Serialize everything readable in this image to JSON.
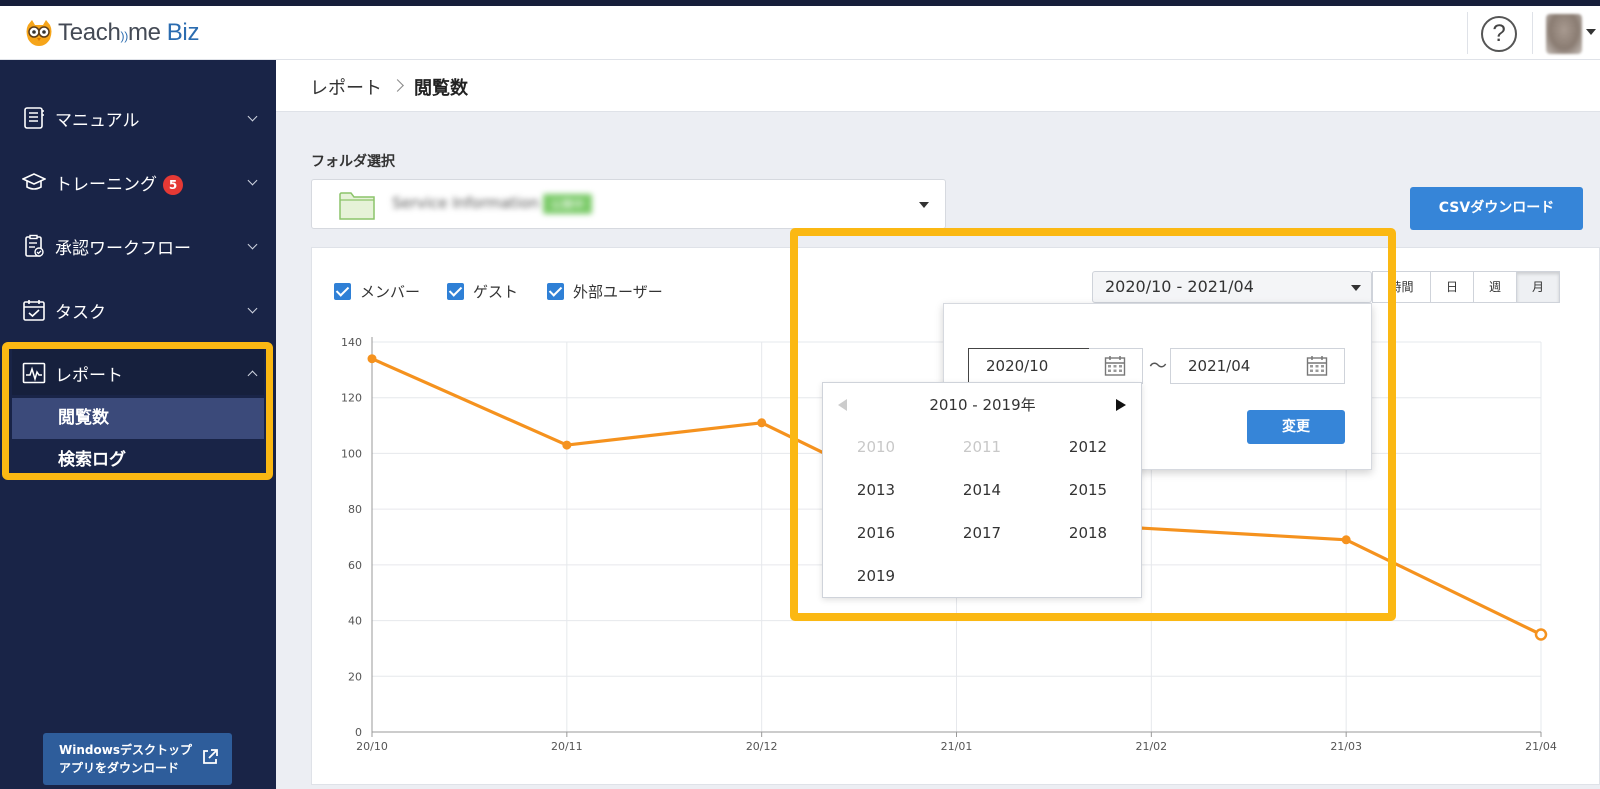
{
  "app": {
    "logo_text": "Teach",
    "logo_text_b": "me",
    "logo_brand": "Biz"
  },
  "header": {
    "help_label": "?"
  },
  "sidebar": {
    "items": [
      {
        "label": "マニュアル",
        "icon": "manual-icon"
      },
      {
        "label": "トレーニング",
        "icon": "graduation-cap-icon",
        "badge": "5"
      },
      {
        "label": "承認ワークフロー",
        "icon": "clipboard-check-icon"
      },
      {
        "label": "タスク",
        "icon": "calendar-check-icon"
      },
      {
        "label": "レポート",
        "icon": "report-chart-icon"
      }
    ],
    "sub_items": [
      {
        "label": "閲覧数"
      },
      {
        "label": "検索ログ"
      }
    ],
    "download_line1": "Windowsデスクトップ",
    "download_line2": "アプリをダウンロード"
  },
  "breadcrumb": {
    "parent": "レポート",
    "current": "閲覧数"
  },
  "folder": {
    "label": "フォルダ選択",
    "name": "Service Information",
    "tag": "公開中"
  },
  "csv_button": "CSVダウンロード",
  "filters": [
    {
      "label": "メンバー",
      "checked": true
    },
    {
      "label": "ゲスト",
      "checked": true
    },
    {
      "label": "外部ユーザー",
      "checked": true
    }
  ],
  "range_select": "2020/10 - 2021/04",
  "granularity": [
    {
      "label": "時間"
    },
    {
      "label": "日"
    },
    {
      "label": "週"
    },
    {
      "label": "月",
      "selected": true
    }
  ],
  "date_range": {
    "from": "2020/10",
    "to": "2021/04",
    "separator": "〜",
    "change_label": "変更"
  },
  "year_picker": {
    "title": "2010 - 2019年",
    "years": [
      {
        "label": "2010",
        "disabled": true
      },
      {
        "label": "2011",
        "disabled": true
      },
      {
        "label": "2012"
      },
      {
        "label": "2013"
      },
      {
        "label": "2014"
      },
      {
        "label": "2015"
      },
      {
        "label": "2016"
      },
      {
        "label": "2017"
      },
      {
        "label": "2018"
      },
      {
        "label": "2019"
      }
    ]
  },
  "colors": {
    "line": "#f5921e",
    "sidebar_bg": "#192447",
    "highlight": "#fbb813",
    "primary": "#3685d8"
  },
  "chart_data": {
    "type": "line",
    "categories": [
      "20/10",
      "20/11",
      "20/12",
      "21/01",
      "21/02",
      "21/03",
      "21/04"
    ],
    "series": [
      {
        "values": [
          134,
          103,
          111,
          77,
          null,
          69,
          35
        ]
      }
    ],
    "yticks": [
      "0",
      "20",
      "40",
      "60",
      "80",
      "100",
      "120",
      "140"
    ],
    "ylim": [
      0,
      140
    ],
    "grid": true
  }
}
